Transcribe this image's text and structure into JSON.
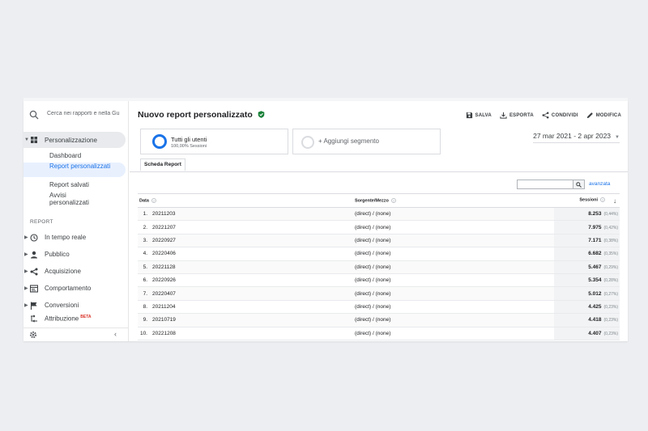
{
  "sidebar": {
    "search_placeholder": "Cerca nei rapporti e nella Gu",
    "personalization_label": "Personalizzazione",
    "sub_items": [
      "Dashboard",
      "Report personalizzati",
      "Report salvati",
      "Avvisi personalizzati"
    ],
    "section_label": "REPORT",
    "nav_items": [
      {
        "label": "In tempo reale",
        "icon": "clock-icon"
      },
      {
        "label": "Pubblico",
        "icon": "person-icon"
      },
      {
        "label": "Acquisizione",
        "icon": "acquisition-icon"
      },
      {
        "label": "Comportamento",
        "icon": "behavior-icon"
      },
      {
        "label": "Conversioni",
        "icon": "flag-icon"
      },
      {
        "label": "Attribuzione",
        "icon": "attribution-icon",
        "badge": "BETA"
      }
    ]
  },
  "header": {
    "title": "Nuovo report personalizzato",
    "actions": [
      "SALVA",
      "ESPORTA",
      "CONDIVIDI",
      "MODIFICA"
    ]
  },
  "segments": {
    "active_name": "Tutti gli utenti",
    "active_sub": "100,00% Sessioni",
    "add_label": "+ Aggiungi segmento"
  },
  "date_range": "27 mar 2021 - 2 apr 2023",
  "tab_label": "Scheda Report",
  "advanced_label": "avanzata",
  "table": {
    "headers": {
      "data": "Data",
      "source": "Sorgente/Mezzo",
      "sessions": "Sessioni"
    },
    "rows": [
      {
        "n": "1.",
        "date": "20211203",
        "source": "(direct) / (none)",
        "sessions": "8.253",
        "pct": "(0,44%)"
      },
      {
        "n": "2.",
        "date": "20221207",
        "source": "(direct) / (none)",
        "sessions": "7.975",
        "pct": "(0,42%)"
      },
      {
        "n": "3.",
        "date": "20220927",
        "source": "(direct) / (none)",
        "sessions": "7.171",
        "pct": "(0,38%)"
      },
      {
        "n": "4.",
        "date": "20220406",
        "source": "(direct) / (none)",
        "sessions": "6.682",
        "pct": "(0,35%)"
      },
      {
        "n": "5.",
        "date": "20221128",
        "source": "(direct) / (none)",
        "sessions": "5.467",
        "pct": "(0,29%)"
      },
      {
        "n": "6.",
        "date": "20220926",
        "source": "(direct) / (none)",
        "sessions": "5.354",
        "pct": "(0,28%)"
      },
      {
        "n": "7.",
        "date": "20220407",
        "source": "(direct) / (none)",
        "sessions": "5.012",
        "pct": "(0,27%)"
      },
      {
        "n": "8.",
        "date": "20211204",
        "source": "(direct) / (none)",
        "sessions": "4.425",
        "pct": "(0,23%)"
      },
      {
        "n": "9.",
        "date": "20210719",
        "source": "(direct) / (none)",
        "sessions": "4.418",
        "pct": "(0,23%)"
      },
      {
        "n": "10.",
        "date": "20221208",
        "source": "(direct) / (none)",
        "sessions": "4.407",
        "pct": "(0,23%)"
      }
    ]
  },
  "colors": {
    "accent": "#1a73e8",
    "verified": "#188038",
    "beta": "#d93025"
  }
}
